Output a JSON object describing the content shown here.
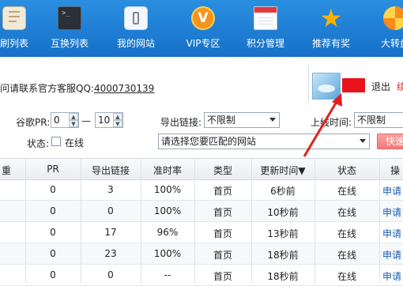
{
  "nav": [
    {
      "label": "刷列表",
      "icon": "clipboard-icon"
    },
    {
      "label": "互换列表",
      "icon": "terminal-icon"
    },
    {
      "label": "我的网站",
      "icon": "phone-icon"
    },
    {
      "label": "VIP专区",
      "icon": "vip-icon"
    },
    {
      "label": "积分管理",
      "icon": "calendar-icon"
    },
    {
      "label": "推荐有奖",
      "icon": "star-icon"
    },
    {
      "label": "大转盘",
      "icon": "wheel-icon"
    }
  ],
  "service": {
    "prefix": "问请联系官方客服QQ:",
    "qq": "4000730139"
  },
  "user": {
    "logout": "退出",
    "extra": "续"
  },
  "filters": {
    "google_pr_label": "谷歌PR:",
    "pr_from": "0",
    "pr_to": "10",
    "pr_sep": "—",
    "outlinks_label": "导出链接:",
    "outlinks_value": "不限制",
    "uptime_label": "上线时间:",
    "uptime_value": "不限制",
    "status_label": "状态:",
    "online_label": "在线",
    "site_select": "请选择您要匹配的网站",
    "quick_button": "快速"
  },
  "table": {
    "headers": [
      "重",
      "PR",
      "导出链接",
      "准时率",
      "类型",
      "更新时间▼",
      "状态",
      "操"
    ],
    "rows": [
      {
        "pr": "0",
        "out": "3",
        "rate": "100%",
        "type": "首页",
        "time": "6秒前",
        "status": "在线",
        "op": "申请"
      },
      {
        "pr": "0",
        "out": "0",
        "rate": "100%",
        "type": "首页",
        "time": "10秒前",
        "status": "在线",
        "op": "申请"
      },
      {
        "pr": "0",
        "out": "17",
        "rate": "96%",
        "type": "首页",
        "time": "13秒前",
        "status": "在线",
        "op": "申请"
      },
      {
        "pr": "0",
        "out": "23",
        "rate": "100%",
        "type": "首页",
        "time": "18秒前",
        "status": "在线",
        "op": "申请"
      },
      {
        "pr": "0",
        "out": "0",
        "rate": "--",
        "type": "首页",
        "time": "18秒前",
        "status": "在线",
        "op": "申请"
      }
    ]
  },
  "colors": {
    "nav_bg": "#1d7fd6",
    "accent_red": "#e8141b",
    "arrow_red": "#e02020",
    "link": "#1a5fb4"
  }
}
